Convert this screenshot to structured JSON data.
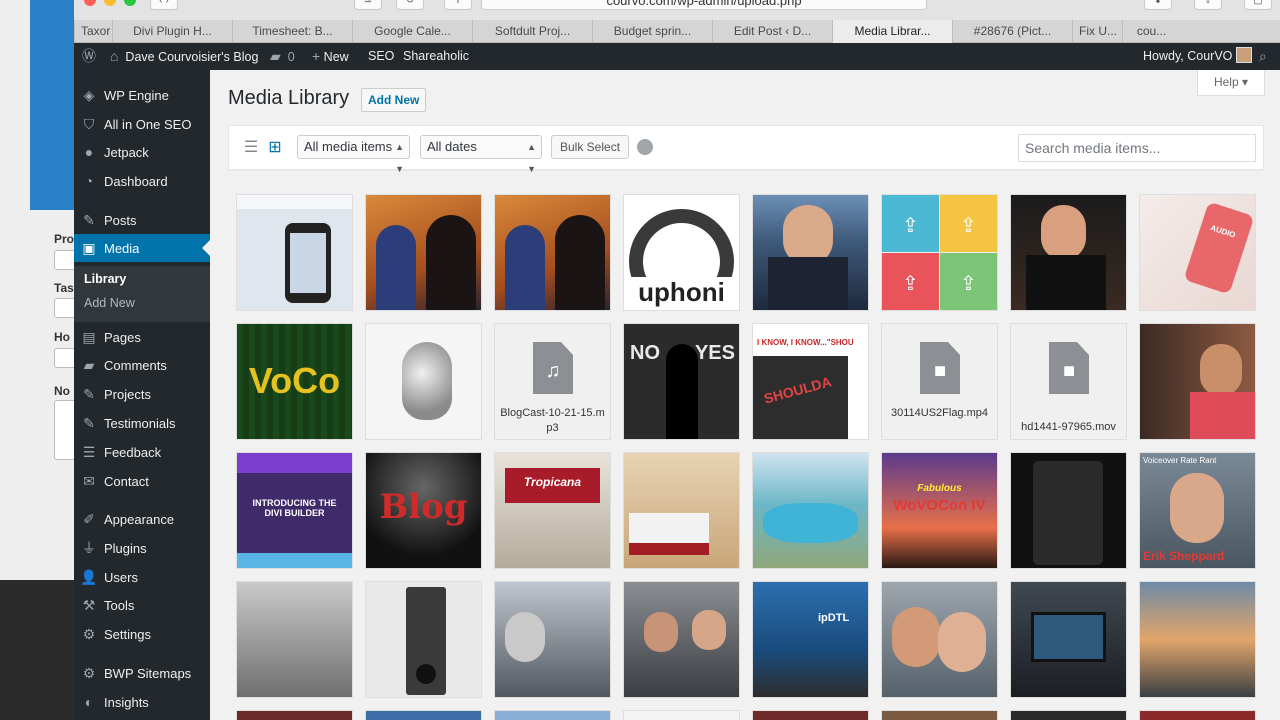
{
  "browser": {
    "url": "courvo.com/wp-admin/upload.php",
    "tabs": [
      {
        "label": "Taxor"
      },
      {
        "label": "Divi Plugin H..."
      },
      {
        "label": "Timesheet: B..."
      },
      {
        "label": "Google Cale..."
      },
      {
        "label": "Softdult Proj..."
      },
      {
        "label": "Budget sprin..."
      },
      {
        "label": "Edit Post ‹ D..."
      },
      {
        "label": "Media Librar..."
      },
      {
        "label": "#28676 (Pict..."
      },
      {
        "label": "Fix U..."
      },
      {
        "label": "cou..."
      }
    ]
  },
  "adminbar": {
    "site_name": "Dave Courvoisier's Blog",
    "comments_count": "0",
    "new_label": "New",
    "seo_label": "SEO",
    "shareaholic_label": "Shareaholic",
    "howdy": "Howdy, CourVO"
  },
  "sidebar": {
    "items": [
      {
        "label": "WP Engine",
        "icon": "wp-engine-icon"
      },
      {
        "label": "All in One SEO",
        "icon": "shield-icon"
      },
      {
        "label": "Jetpack",
        "icon": "jetpack-icon"
      },
      {
        "label": "Dashboard",
        "icon": "dashboard-icon"
      },
      {
        "label": "Posts",
        "icon": "pin-icon"
      },
      {
        "label": "Media",
        "icon": "media-icon"
      },
      {
        "label": "Pages",
        "icon": "pages-icon"
      },
      {
        "label": "Comments",
        "icon": "comments-icon"
      },
      {
        "label": "Projects",
        "icon": "pin-icon"
      },
      {
        "label": "Testimonials",
        "icon": "pin-icon"
      },
      {
        "label": "Feedback",
        "icon": "feedback-icon"
      },
      {
        "label": "Contact",
        "icon": "mail-icon"
      },
      {
        "label": "Appearance",
        "icon": "brush-icon"
      },
      {
        "label": "Plugins",
        "icon": "plug-icon"
      },
      {
        "label": "Users",
        "icon": "user-icon"
      },
      {
        "label": "Tools",
        "icon": "wrench-icon"
      },
      {
        "label": "Settings",
        "icon": "settings-icon"
      },
      {
        "label": "BWP Sitemaps",
        "icon": "sitemap-icon"
      },
      {
        "label": "Insights",
        "icon": "insights-icon"
      }
    ],
    "submenu": {
      "library": "Library",
      "add_new": "Add New"
    }
  },
  "main": {
    "help_label": "Help",
    "title": "Media Library",
    "add_new_label": "Add New",
    "filters": {
      "media_type": "All media items",
      "dates": "All dates",
      "bulk_select": "Bulk Select",
      "search_placeholder": "Search media items..."
    },
    "files": {
      "mp3": "BlogCast-10-21-15.mp3",
      "mp4": "30114US2Flag.mp4",
      "mov": "hd1441-97965.mov"
    },
    "thumb_text": {
      "auphonic": "uphoni",
      "voco": "VoCo",
      "no_yes_left": "NO",
      "no_yes_right": "YES",
      "shoulda_top": "I KNOW, I KNOW...\"SHOU",
      "shoulda": "SHOULDA",
      "divi": "INTRODUCING THE DIVI BUILDER",
      "blog": "Blog",
      "tropicana": "Tropicana",
      "wovocon": "WoVOCon IV",
      "fabulous": "Fabulous",
      "rate_rant": "Voiceover Rate Rant",
      "erik": "Erik Sheppard",
      "audio": "AUDIO",
      "ipdtl": "ipDTL"
    }
  }
}
